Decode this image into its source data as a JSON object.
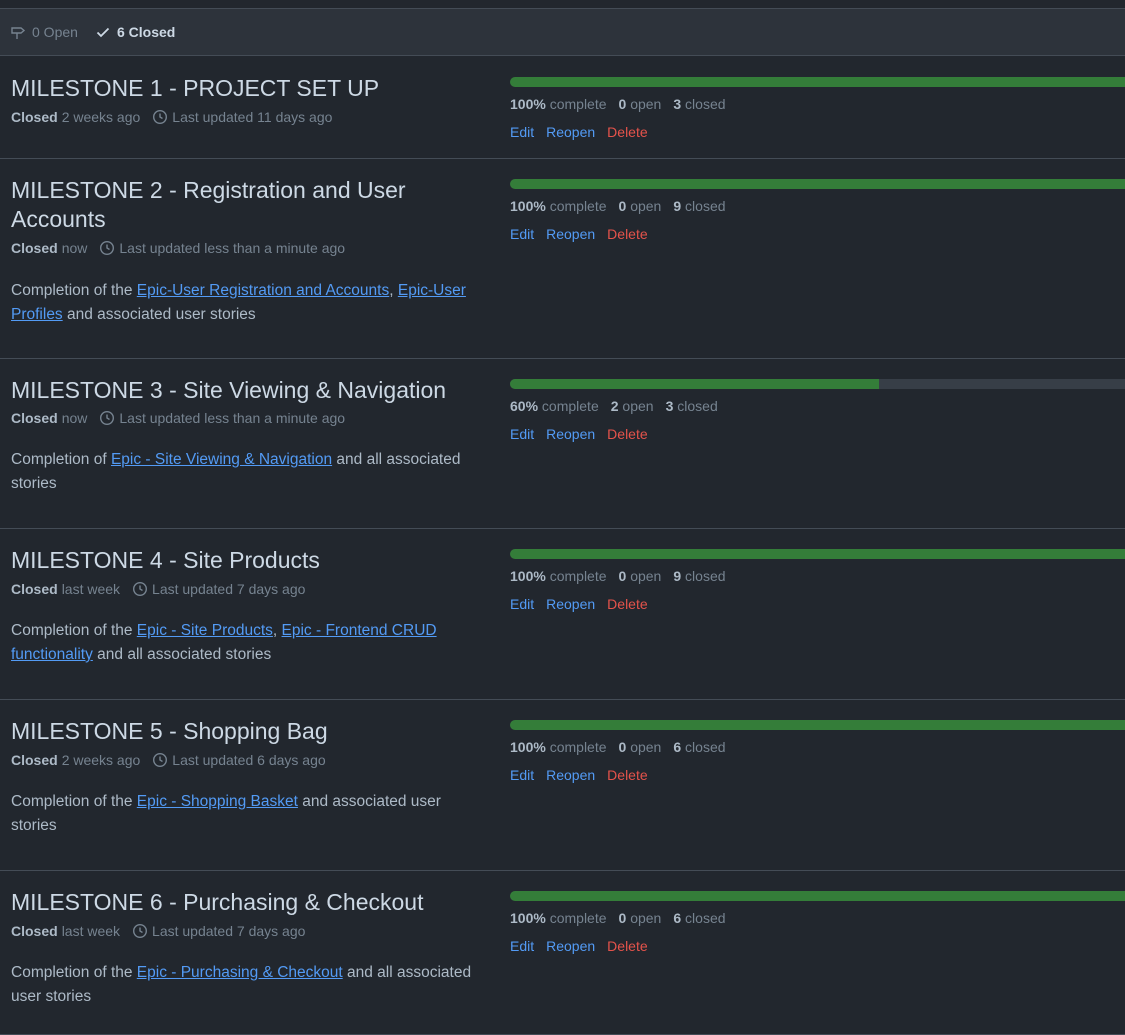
{
  "filters": {
    "open_label": "0 Open",
    "closed_label": "6 Closed"
  },
  "actions": {
    "edit": "Edit",
    "reopen": "Reopen",
    "delete": "Delete"
  },
  "colors": {
    "progress_fill": "#347d39",
    "link": "#539bf5",
    "delete": "#e5534b"
  },
  "milestones": [
    {
      "title": "MILESTONE 1 - PROJECT SET UP",
      "closed_label": "Closed",
      "closed_when": "2 weeks ago",
      "updated": "Last updated 11 days ago",
      "progress": 1.0,
      "complete_pct": "100%",
      "complete_word": "complete",
      "open_count": "0",
      "open_word": "open",
      "closed_count": "3",
      "closed_word": "closed",
      "description": []
    },
    {
      "title": "MILESTONE 2 - Registration and User Accounts",
      "closed_label": "Closed",
      "closed_when": "now",
      "updated": "Last updated less than a minute ago",
      "progress": 1.0,
      "complete_pct": "100%",
      "complete_word": "complete",
      "open_count": "0",
      "open_word": "open",
      "closed_count": "9",
      "closed_word": "closed",
      "description": [
        {
          "text": "Completion of the "
        },
        {
          "link": "Epic-User Registration and Accounts"
        },
        {
          "text": ", "
        },
        {
          "link": "Epic-User Profiles"
        },
        {
          "text": " and associated user stories"
        }
      ]
    },
    {
      "title": "MILESTONE 3 - Site Viewing & Navigation",
      "closed_label": "Closed",
      "closed_when": "now",
      "updated": "Last updated less than a minute ago",
      "progress": 0.6,
      "complete_pct": "60%",
      "complete_word": "complete",
      "open_count": "2",
      "open_word": "open",
      "closed_count": "3",
      "closed_word": "closed",
      "description": [
        {
          "text": "Completion of "
        },
        {
          "link": "Epic - Site Viewing & Navigation"
        },
        {
          "text": " and all associated stories"
        }
      ]
    },
    {
      "title": "MILESTONE 4 - Site Products",
      "closed_label": "Closed",
      "closed_when": "last week",
      "updated": "Last updated 7 days ago",
      "progress": 1.0,
      "complete_pct": "100%",
      "complete_word": "complete",
      "open_count": "0",
      "open_word": "open",
      "closed_count": "9",
      "closed_word": "closed",
      "description": [
        {
          "text": "Completion of the "
        },
        {
          "link": "Epic - Site Products"
        },
        {
          "text": ", "
        },
        {
          "link": "Epic - Frontend CRUD functionality"
        },
        {
          "text": " and all associated stories"
        }
      ]
    },
    {
      "title": "MILESTONE 5 - Shopping Bag",
      "closed_label": "Closed",
      "closed_when": "2 weeks ago",
      "updated": "Last updated 6 days ago",
      "progress": 1.0,
      "complete_pct": "100%",
      "complete_word": "complete",
      "open_count": "0",
      "open_word": "open",
      "closed_count": "6",
      "closed_word": "closed",
      "description": [
        {
          "text": "Completion of the "
        },
        {
          "link": "Epic - Shopping Basket"
        },
        {
          "text": " and associated user stories"
        }
      ]
    },
    {
      "title": "MILESTONE 6 - Purchasing & Checkout",
      "closed_label": "Closed",
      "closed_when": "last week",
      "updated": "Last updated 7 days ago",
      "progress": 1.0,
      "complete_pct": "100%",
      "complete_word": "complete",
      "open_count": "0",
      "open_word": "open",
      "closed_count": "6",
      "closed_word": "closed",
      "description": [
        {
          "text": "Completion of the "
        },
        {
          "link": "Epic - Purchasing & Checkout"
        },
        {
          "text": " and all associated user stories"
        }
      ]
    }
  ]
}
